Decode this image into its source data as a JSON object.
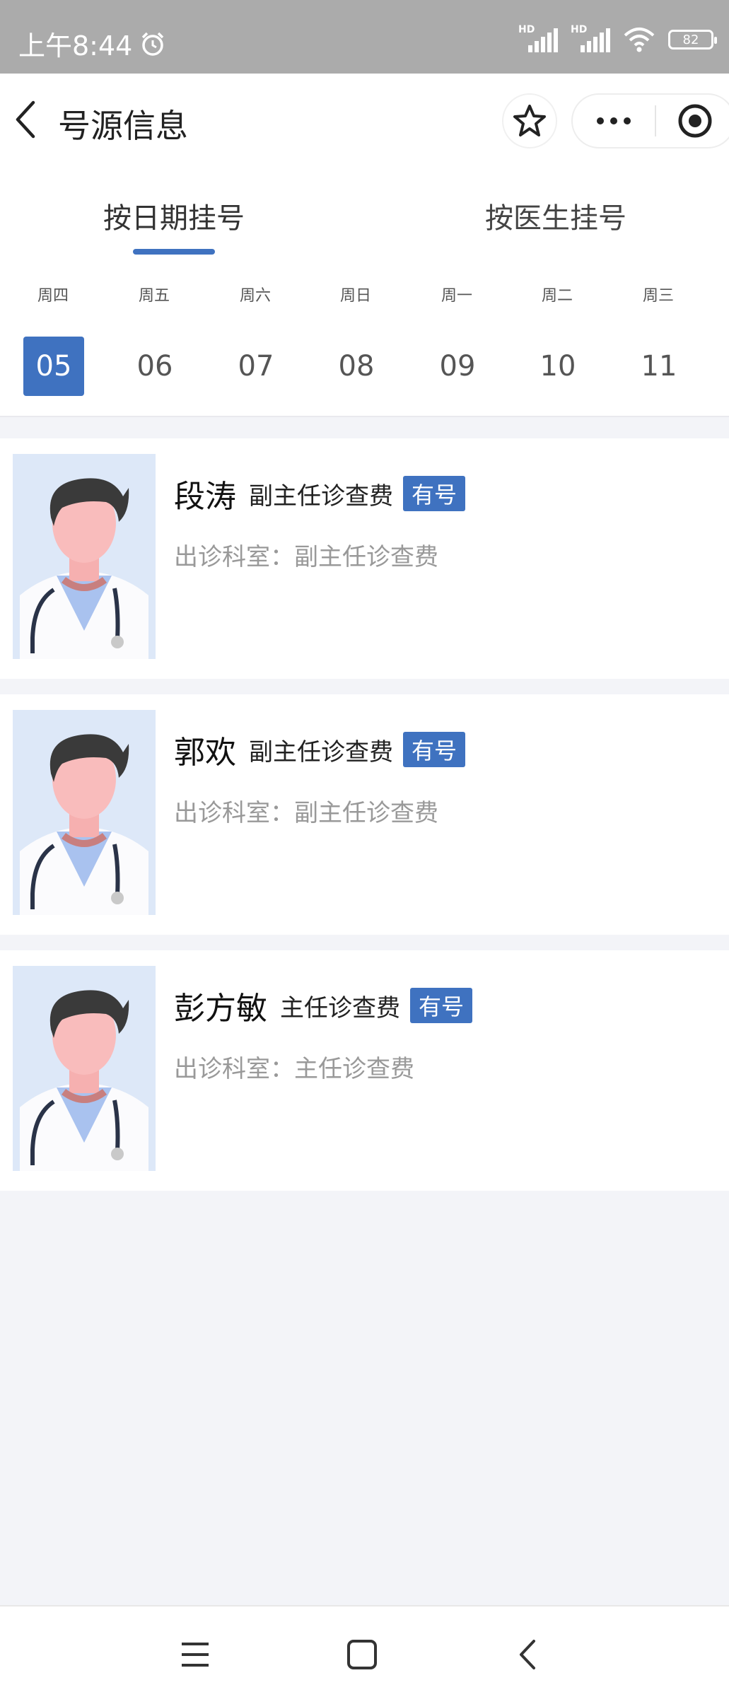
{
  "status_bar": {
    "time": "上午8:44",
    "signal1_label": "HD",
    "signal2_label": "HD",
    "battery": "82"
  },
  "header": {
    "title": "号源信息"
  },
  "tabs": [
    {
      "label": "按日期挂号",
      "active": true
    },
    {
      "label": "按医生挂号",
      "active": false
    }
  ],
  "week": [
    {
      "weekday": "周四",
      "date": "05",
      "selected": true
    },
    {
      "weekday": "周五",
      "date": "06",
      "selected": false
    },
    {
      "weekday": "周六",
      "date": "07",
      "selected": false
    },
    {
      "weekday": "周日",
      "date": "08",
      "selected": false
    },
    {
      "weekday": "周一",
      "date": "09",
      "selected": false
    },
    {
      "weekday": "周二",
      "date": "10",
      "selected": false
    },
    {
      "weekday": "周三",
      "date": "11",
      "selected": false
    }
  ],
  "doctors": [
    {
      "name": "段涛",
      "title": "副主任诊查费",
      "badge": "有号",
      "dept": "出诊科室：副主任诊查费"
    },
    {
      "name": "郭欢",
      "title": "副主任诊查费",
      "badge": "有号",
      "dept": "出诊科室：副主任诊查费"
    },
    {
      "name": "彭方敏",
      "title": "主任诊查费",
      "badge": "有号",
      "dept": "出诊科室：主任诊查费"
    }
  ],
  "colors": {
    "accent": "#3f72c0",
    "background": "#f3f4f8",
    "status_bar": "#ababab",
    "secondary_text": "#999999"
  },
  "icons": [
    "alarm-icon",
    "signal-icon",
    "wifi-icon",
    "battery-icon",
    "back-arrow-icon",
    "star-icon",
    "more-icon",
    "target-icon",
    "menu-icon",
    "home-icon",
    "back-icon",
    "doctor-avatar"
  ]
}
